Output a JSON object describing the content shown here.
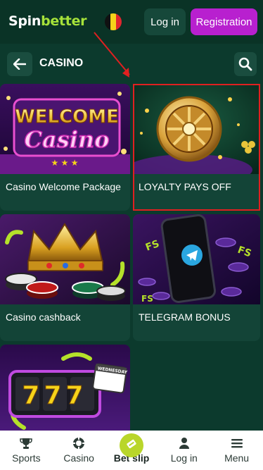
{
  "header": {
    "logo_part1": "Spin",
    "logo_part2": "better",
    "login_label": "Log in",
    "registration_label": "Registration"
  },
  "section": {
    "title": "CASINO"
  },
  "cards": [
    {
      "caption": "Casino Welcome Package",
      "art_text_top": "WELCOME",
      "art_text_bottom": "Casino"
    },
    {
      "caption": "LOYALTY PAYS OFF"
    },
    {
      "caption": "Casino cashback"
    },
    {
      "caption": "TELEGRAM BONUS",
      "art_badge": "FS"
    },
    {
      "caption": "",
      "art_text": "777",
      "art_calendar": "WEDNESDAY"
    }
  ],
  "bottom_nav": [
    {
      "label": "Sports",
      "icon": "trophy-icon"
    },
    {
      "label": "Casino",
      "icon": "chip-icon"
    },
    {
      "label": "Bet slip",
      "icon": "ticket-icon"
    },
    {
      "label": "Log in",
      "icon": "user-icon"
    },
    {
      "label": "Menu",
      "icon": "menu-icon"
    }
  ],
  "colors": {
    "background": "#0c3a2d",
    "accent_green": "#a6e23a",
    "registration": "#b820cf",
    "highlight": "#e02020"
  }
}
